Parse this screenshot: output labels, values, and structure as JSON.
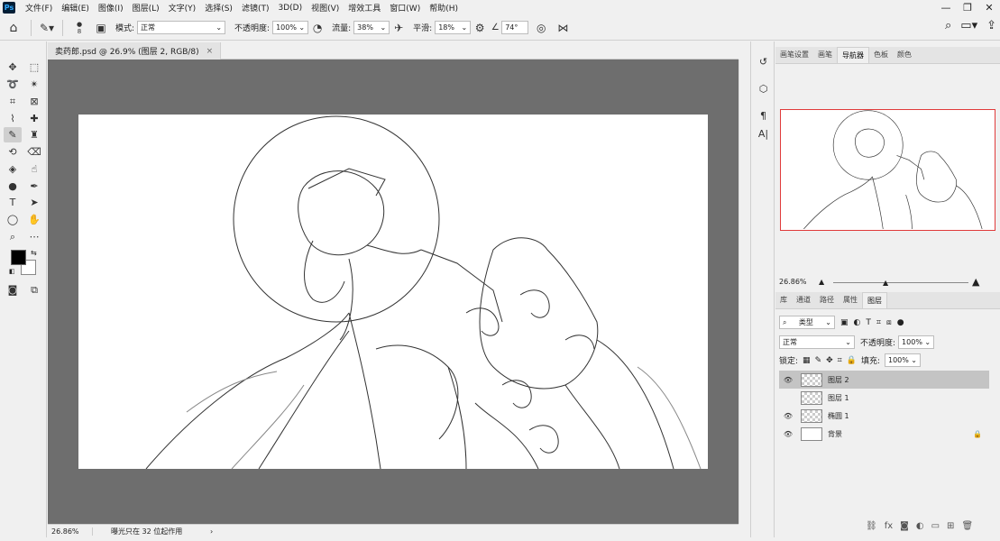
{
  "app": {
    "logo": "Ps"
  },
  "menu": [
    "文件(F)",
    "编辑(E)",
    "图像(I)",
    "图层(L)",
    "文字(Y)",
    "选择(S)",
    "滤镜(T)",
    "3D(D)",
    "视图(V)",
    "增效工具",
    "窗口(W)",
    "帮助(H)"
  ],
  "options": {
    "brush_size": "8",
    "mode_label": "模式:",
    "mode_value": "正常",
    "opacity_label": "不透明度:",
    "opacity_value": "100%",
    "flow_label": "流量:",
    "flow_value": "38%",
    "smooth_label": "平滑:",
    "smooth_value": "18%",
    "angle_value": "74°"
  },
  "document": {
    "tab_title": "卖药郎.psd @ 26.9% (图层 2, RGB/8)",
    "close": "×"
  },
  "status": {
    "zoom": "26.86%",
    "info": "曝光只在 32 位起作用",
    "arrow": "›"
  },
  "navigator_panel": {
    "tabs": [
      "画笔设置",
      "画笔",
      "导航器",
      "色板",
      "颜色"
    ],
    "active_tab": "导航器",
    "zoom": "26.86%"
  },
  "layers_panel": {
    "tabs": [
      "库",
      "通道",
      "路径",
      "属性",
      "图层"
    ],
    "active_tab": "图层",
    "filter_label": "类型",
    "blend_mode": "正常",
    "opacity_label": "不透明度:",
    "opacity_value": "100%",
    "lock_label": "锁定:",
    "fill_label": "填充:",
    "fill_value": "100%",
    "layers": [
      {
        "name": "图层 2",
        "visible": true,
        "selected": true,
        "kind": "checker"
      },
      {
        "name": "图层 1",
        "visible": false,
        "selected": false,
        "kind": "checker"
      },
      {
        "name": "椭圆 1",
        "visible": true,
        "selected": false,
        "kind": "shape"
      },
      {
        "name": "背景",
        "visible": true,
        "selected": false,
        "kind": "white",
        "locked": true
      }
    ]
  },
  "colors": {
    "accent_red": "#e03b3b",
    "foreground": "#000000",
    "background": "#ffffff",
    "canvas_bg": "#6e6e6e"
  }
}
